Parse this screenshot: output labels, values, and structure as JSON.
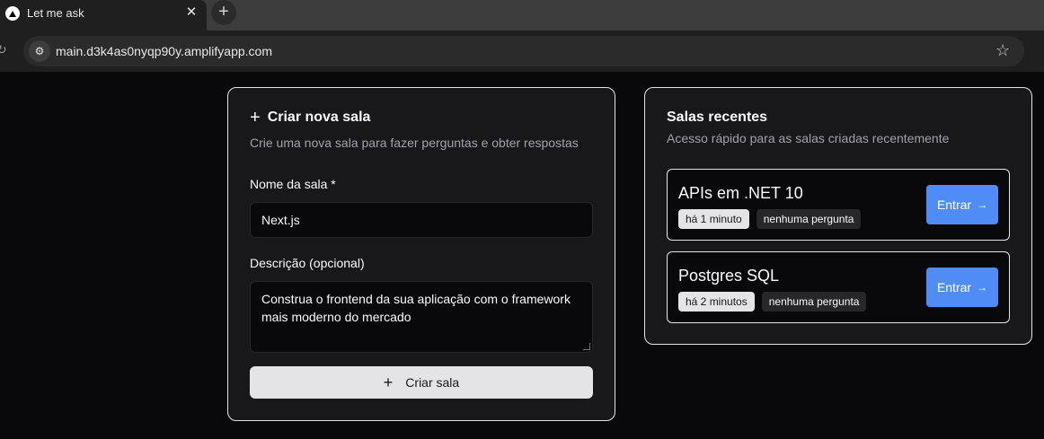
{
  "browser": {
    "tab_title": "Let me ask",
    "tab_close": "✕",
    "new_tab": "+",
    "url": "main.d3k4as0nyqp90y.amplifyapp.com"
  },
  "create_room": {
    "title": "Criar nova sala",
    "description": "Crie uma nova sala para fazer perguntas e obter respostas",
    "name_label": "Nome da sala *",
    "name_value": "Next.js",
    "desc_label": "Descrição (opcional)",
    "desc_value": "Construa o frontend da sua aplicação com o framework mais moderno do mercado",
    "submit_label": "Criar sala"
  },
  "recent_rooms": {
    "title": "Salas recentes",
    "description": "Acesso rápido para as salas criadas recentemente",
    "items": [
      {
        "name": "APIs em .NET 10",
        "time": "há 1 minuto",
        "questions": "nenhuma pergunta",
        "action": "Entrar"
      },
      {
        "name": "Postgres SQL",
        "time": "há 2 minutos",
        "questions": "nenhuma pergunta",
        "action": "Entrar"
      }
    ]
  },
  "colors": {
    "background": "#09090b",
    "card": "#18181b",
    "accent_button": "#4f8cf6",
    "primary_button": "#e4e4e7"
  }
}
